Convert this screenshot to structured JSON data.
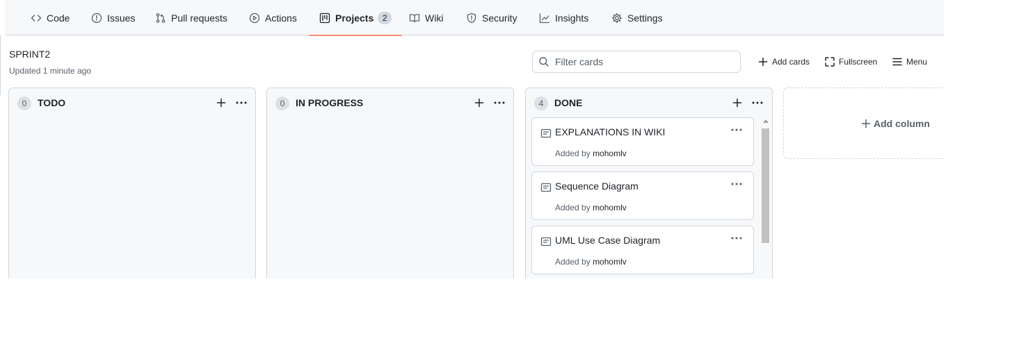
{
  "nav": {
    "items": [
      {
        "label": "Code",
        "icon": "code-icon"
      },
      {
        "label": "Issues",
        "icon": "issue-opened-icon"
      },
      {
        "label": "Pull requests",
        "icon": "git-pull-request-icon"
      },
      {
        "label": "Actions",
        "icon": "play-icon"
      },
      {
        "label": "Projects",
        "icon": "project-icon",
        "counter": "2",
        "selected": true
      },
      {
        "label": "Wiki",
        "icon": "book-icon"
      },
      {
        "label": "Security",
        "icon": "shield-icon"
      },
      {
        "label": "Insights",
        "icon": "graph-icon"
      },
      {
        "label": "Settings",
        "icon": "gear-icon"
      }
    ]
  },
  "project": {
    "title": "SPRINT2",
    "updated": "Updated 1 minute ago"
  },
  "toolbar": {
    "filter_placeholder": "Filter cards",
    "add_cards_label": "Add cards",
    "fullscreen_label": "Fullscreen",
    "menu_label": "Menu"
  },
  "columns": [
    {
      "count": "0",
      "name": "TODO",
      "cards": []
    },
    {
      "count": "0",
      "name": "IN PROGRESS",
      "cards": []
    },
    {
      "count": "4",
      "name": "DONE",
      "cards": [
        {
          "title": "EXPLANATIONS IN WIKI",
          "added_by_label": "Added by",
          "author": "mohomlv"
        },
        {
          "title": "Sequence Diagram",
          "added_by_label": "Added by",
          "author": "mohomlv"
        },
        {
          "title": "UML Use Case Diagram",
          "added_by_label": "Added by",
          "author": "mohomlv"
        }
      ]
    }
  ],
  "add_column_label": "Add column",
  "colors": {
    "accent_underline": "#fd8c73",
    "border": "#d0d7de",
    "muted_text": "#57606a",
    "column_bg": "#f6f8fa"
  }
}
